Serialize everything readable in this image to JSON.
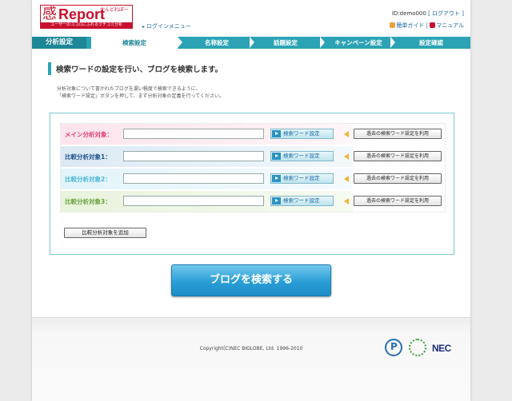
{
  "header": {
    "logo_text": "Report",
    "logo_kanji": "感",
    "logo_kana": "かんどれぽーと",
    "logo_tagline": "ユーザーのココロにふれるクチコミ分析",
    "login_menu": "ログインメニュー",
    "user_id": "ID:demo000",
    "logout": "[ ログアウト ]",
    "guide": "簡単ガイド",
    "divider": "|",
    "manual": "マニュアル"
  },
  "nav": {
    "section": "分析設定",
    "steps": [
      "検索設定",
      "名称設定",
      "話題設定",
      "キャンペーン設定",
      "設定確認"
    ],
    "active_step": "検索設定"
  },
  "main": {
    "title": "検索ワードの設定を行い、ブログを検索します。",
    "desc_line1": "分析対象について書かれたブログを漏い積度で検索できるように、",
    "desc_line2": "「検索ワード設定」ボタンを押して、まず分析対象の定義を行ってください。",
    "rows": [
      {
        "label": "メイン分析対象：",
        "value": "",
        "search_btn": "検索ワード設定",
        "past_btn": "過去の検索ワード設定を利用"
      },
      {
        "label": "比較分析対象1：",
        "value": "",
        "search_btn": "検索ワード設定",
        "past_btn": "過去の検索ワード設定を利用"
      },
      {
        "label": "比較分析対象2：",
        "value": "",
        "search_btn": "検索ワード設定",
        "past_btn": "過去の検索ワード設定を利用"
      },
      {
        "label": "比較分析対象3：",
        "value": "",
        "search_btn": "検索ワード設定",
        "past_btn": "過去の検索ワード設定を利用"
      }
    ],
    "add_button": "比較分析対象を追加",
    "search_button": "ブログを検索する"
  },
  "footer": {
    "copyright": "Copyright(C)NEC BIGLOBE, Ltd. 1996-2010",
    "brand": "NEC"
  },
  "colors": {
    "accent": "#2ba3b5",
    "brand_red": "#c8102e",
    "row1_label": "#e0407a",
    "row2_label": "#1a4f8a",
    "row3_label": "#49b6d8",
    "row4_label": "#6aa03a"
  }
}
